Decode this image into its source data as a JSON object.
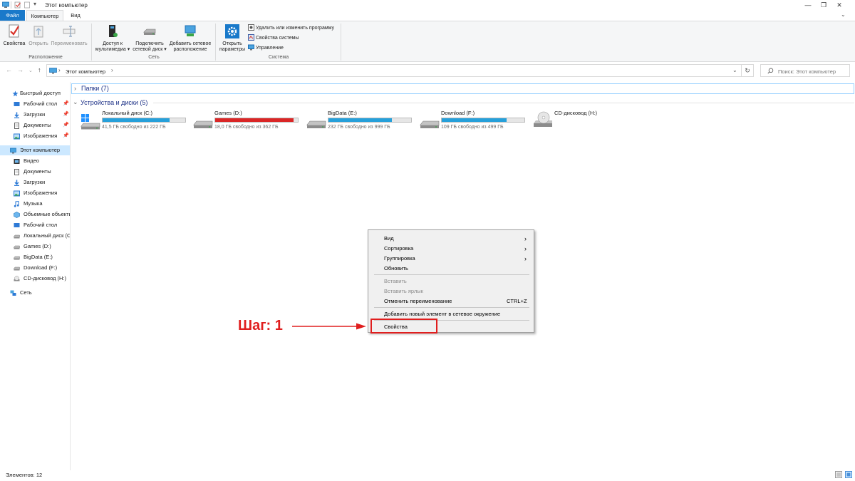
{
  "window": {
    "title": "Этот компьютер",
    "controls": [
      "—",
      "❐",
      "✕"
    ]
  },
  "ribbon_tabs": [
    "Файл",
    "Компьютер",
    "Вид"
  ],
  "ribbon": {
    "location_group": {
      "label": "Расположение",
      "buttons": [
        "Свойства",
        "Открыть",
        "Переименовать"
      ]
    },
    "network_group": {
      "label": "Сеть",
      "buttons": [
        [
          "Доступ к",
          "мультимедиа ▾"
        ],
        [
          "Подключить",
          "сетевой диск ▾"
        ],
        [
          "Добавить сетевое",
          "расположение"
        ]
      ]
    },
    "system_group": {
      "label": "Система",
      "open_params": [
        "Открыть",
        "параметры"
      ],
      "small_buttons": [
        "Удалить или изменить программу",
        "Свойства системы",
        "Управление"
      ]
    }
  },
  "address_bar": {
    "path": "Этот компьютер",
    "search_placeholder": "Поиск: Этот компьютер"
  },
  "nav_pane": {
    "quick_access": "Быстрый доступ",
    "quick_items": [
      "Рабочий стол",
      "Загрузки",
      "Документы",
      "Изображения"
    ],
    "this_pc": "Этот компьютер",
    "pc_items": [
      "Видео",
      "Документы",
      "Загрузки",
      "Изображения",
      "Музыка",
      "Объемные объекты",
      "Рабочий стол",
      "Локальный диск (C:)",
      "Games (D:)",
      "BigData (E:)",
      "Download (F:)",
      "CD-дисковод (H:)"
    ],
    "network": "Сеть"
  },
  "content": {
    "folders_header": "Папки (7)",
    "devices_header": "Устройства и диски (5)",
    "drives": [
      {
        "name": "Локальный диск (C:)",
        "free": "41,5 ГБ свободно из 222 ГБ",
        "used_fraction": 0.813,
        "bar_color": "#26a0da"
      },
      {
        "name": "Games (D:)",
        "free": "18,0 ГБ свободно из 362 ГБ",
        "used_fraction": 0.95,
        "bar_color": "#da2626"
      },
      {
        "name": "BigData (E:)",
        "free": "232 ГБ свободно из 999 ГБ",
        "used_fraction": 0.768,
        "bar_color": "#26a0da"
      },
      {
        "name": "Download (F:)",
        "free": "109 ГБ свободно из 499 ГБ",
        "used_fraction": 0.782,
        "bar_color": "#26a0da"
      },
      {
        "name": "CD-дисковод (H:)",
        "free": "",
        "used_fraction": null,
        "bar_color": null
      }
    ]
  },
  "context_menu": {
    "items": [
      {
        "label": "Вид",
        "submenu": true
      },
      {
        "label": "Сортировка",
        "submenu": true
      },
      {
        "label": "Группировка",
        "submenu": true
      },
      {
        "label": "Обновить"
      },
      {
        "label": "Вставить",
        "disabled": true
      },
      {
        "label": "Вставить ярлык",
        "disabled": true
      },
      {
        "label": "Отменить переименование",
        "shortcut": "CTRL+Z"
      },
      {
        "label": "Добавить новый элемент в сетевое окружение"
      },
      {
        "label": "Свойства"
      }
    ]
  },
  "annotation": {
    "step_label": "Шаг: 1",
    "color": "#e01e1e"
  },
  "status_bar": {
    "items_count": "Элементов: 12"
  }
}
